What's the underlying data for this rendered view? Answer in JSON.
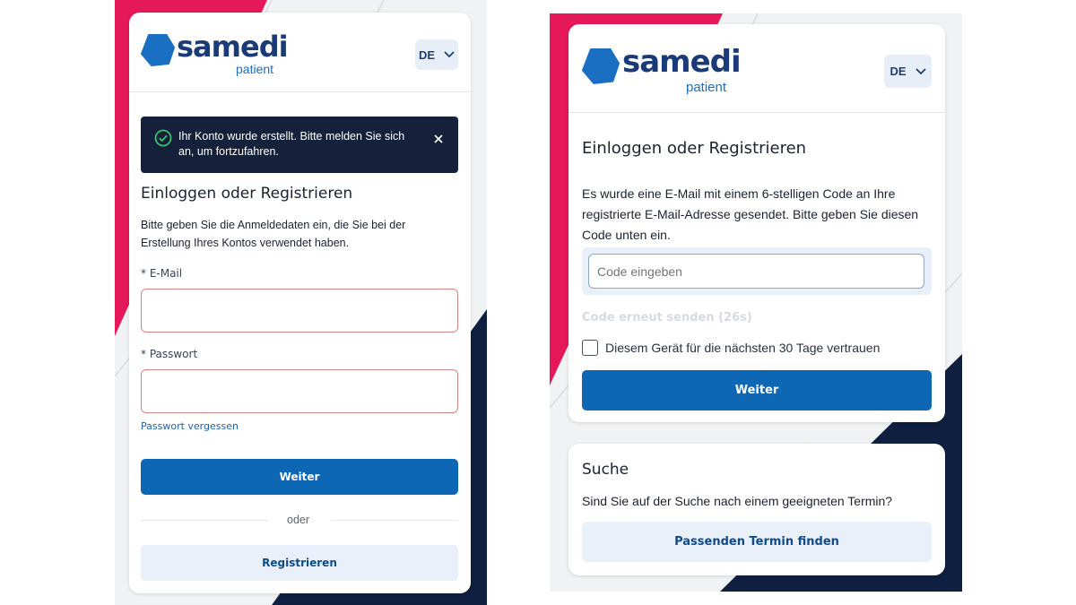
{
  "colors": {
    "brand_dark": "#1a3b78",
    "brand_blue": "#1a6fc2",
    "primary_button": "#0d67b5",
    "accent_pink": "#e5185a",
    "navy": "#0f1f3f",
    "toast_bg": "#15213a",
    "success_green": "#37c26e"
  },
  "left": {
    "logo": {
      "name": "samedi",
      "sub": "patient",
      "icon": "hexagon-logo-icon"
    },
    "language": {
      "value": "DE",
      "icon": "chevron-down-icon"
    },
    "toast": {
      "message": "Ihr Konto wurde erstellt. Bitte melden Sie sich an, um fortzufahren.",
      "status_icon": "check-circle-icon",
      "close_icon": "close-icon"
    },
    "heading": "Einloggen oder Registrieren",
    "description": "Bitte geben Sie die Anmeldedaten ein, die Sie bei der Erstellung Ihres Kontos verwendet haben.",
    "email": {
      "label": "* E-Mail",
      "value": ""
    },
    "password": {
      "label": "* Passwort",
      "value": ""
    },
    "forgot_password": "Passwort vergessen",
    "continue_label": "Weiter",
    "or_label": "oder",
    "register_label": "Registrieren"
  },
  "right": {
    "logo": {
      "name": "samedi",
      "sub": "patient",
      "icon": "hexagon-logo-icon"
    },
    "language": {
      "value": "DE",
      "icon": "chevron-down-icon"
    },
    "heading": "Einloggen oder Registrieren",
    "description": "Es wurde eine E-Mail mit einem 6-stelligen Code an Ihre registrierte E-Mail-Adresse gesendet. Bitte geben Sie diesen Code unten ein.",
    "code_input": {
      "placeholder": "Code eingeben",
      "value": ""
    },
    "resend_label": "Code erneut senden (26s)",
    "trust_device": {
      "label": "Diesem Gerät für die nächsten 30 Tage vertrauen",
      "checked": false
    },
    "continue_label": "Weiter",
    "search_card": {
      "title": "Suche",
      "question": "Sind Sie auf der Suche nach einem geeigneten Termin?",
      "button_label": "Passenden Termin finden"
    }
  }
}
